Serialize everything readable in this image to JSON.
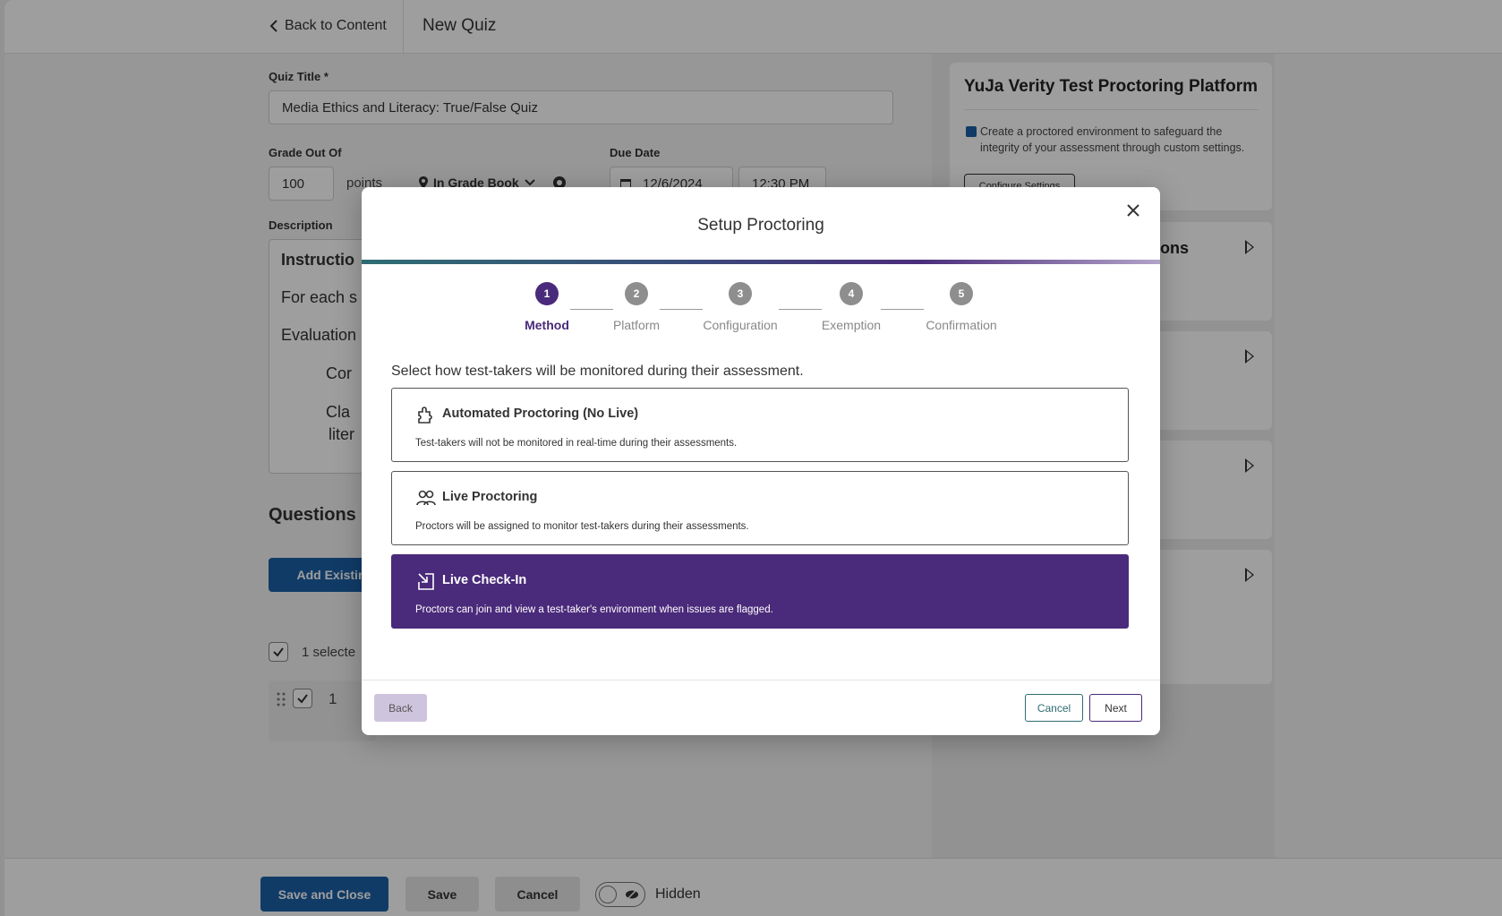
{
  "topbar": {
    "back_label": "Back to Content",
    "page_title": "New Quiz"
  },
  "form": {
    "quiz_title_label": "Quiz Title *",
    "quiz_title_value": "Media Ethics and Literacy: True/False Quiz",
    "grade_label": "Grade Out Of",
    "grade_value": "100",
    "points_label": "points",
    "gradebook_label": "In Grade Book",
    "due_date_label": "Due Date",
    "due_date_value": "12/6/2024",
    "due_time_value": "12:30 PM",
    "description_label": "Description",
    "description_lines": [
      "Instructio",
      "For each s",
      "Evaluation",
      "Cor",
      "Cla",
      "liter"
    ]
  },
  "questions": {
    "heading": "Questions",
    "add_existing_label": "Add Existin",
    "selected_text": "1 selecte",
    "row_number": "1"
  },
  "sidebar": {
    "platform_title": "YuJa Verity Test Proctoring Platform",
    "platform_desc": "Create a proctored environment to safeguard the integrity of your assessment through custom settings.",
    "configure_label": "Configure Settings",
    "accordion_partial_title": "ions"
  },
  "footer": {
    "save_close_label": "Save and Close",
    "save_label": "Save",
    "cancel_label": "Cancel",
    "hidden_label": "Hidden"
  },
  "modal": {
    "title": "Setup Proctoring",
    "steps": [
      {
        "number": "1",
        "label": "Method"
      },
      {
        "number": "2",
        "label": "Platform"
      },
      {
        "number": "3",
        "label": "Configuration"
      },
      {
        "number": "4",
        "label": "Exemption"
      },
      {
        "number": "5",
        "label": "Confirmation"
      }
    ],
    "active_step": 1,
    "prompt": "Select how test-takers will be monitored during their assessment.",
    "options": [
      {
        "title": "Automated Proctoring (No Live)",
        "desc": "Test-takers will not be monitored in real-time during their assessments.",
        "icon": "puzzle-icon"
      },
      {
        "title": "Live Proctoring",
        "desc": "Proctors will be assigned to monitor test-takers during their assessments.",
        "icon": "users-icon"
      },
      {
        "title": "Live Check-In",
        "desc": "Proctors can join and view a test-taker's environment when issues are flagged.",
        "icon": "check-in-icon"
      }
    ],
    "selected_option": 2,
    "back_label": "Back",
    "cancel_label": "Cancel",
    "next_label": "Next"
  },
  "colors": {
    "accent_purple": "#4a2a7a",
    "primary_blue": "#1a5fa6",
    "teal": "#2f6d73"
  }
}
